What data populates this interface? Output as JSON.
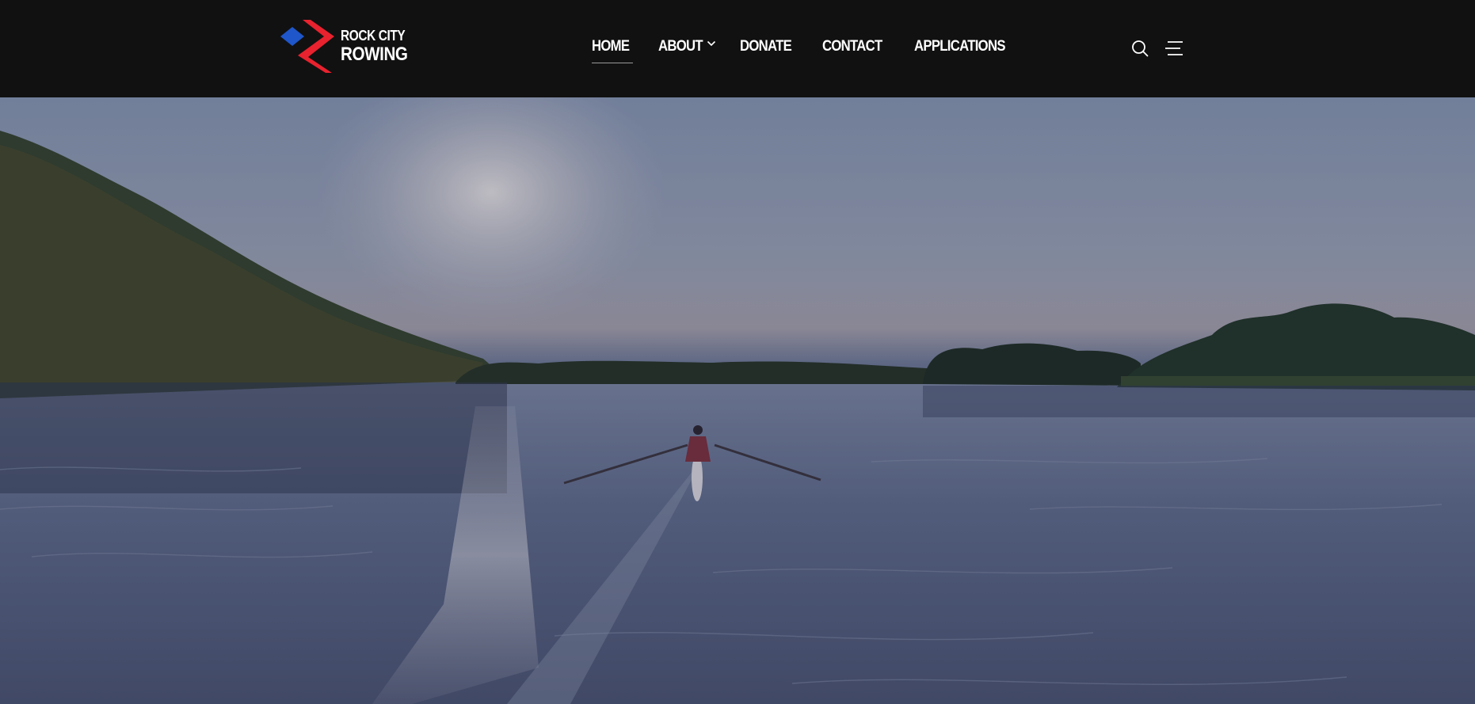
{
  "site": {
    "name_line1": "ROCK CITY",
    "name_line2": "ROWING"
  },
  "nav": {
    "items": [
      {
        "label": "HOME",
        "active": true,
        "has_dropdown": false
      },
      {
        "label": "ABOUT",
        "active": false,
        "has_dropdown": true
      },
      {
        "label": "DONATE",
        "active": false,
        "has_dropdown": false
      },
      {
        "label": "CONTACT",
        "active": false,
        "has_dropdown": false
      },
      {
        "label": "APPLICATIONS",
        "active": false,
        "has_dropdown": false
      }
    ]
  },
  "header_icons": {
    "search": "search-icon",
    "menu": "hamburger-menu-icon",
    "dropdown": "chevron-down-icon"
  },
  "hero": {
    "media": "rower-on-lake-video"
  },
  "colors": {
    "header_bg": "#111111",
    "logo_red": "#e8222e",
    "logo_blue": "#1f56c9",
    "text": "#ffffff",
    "active_underline": "#9a9a9a"
  }
}
